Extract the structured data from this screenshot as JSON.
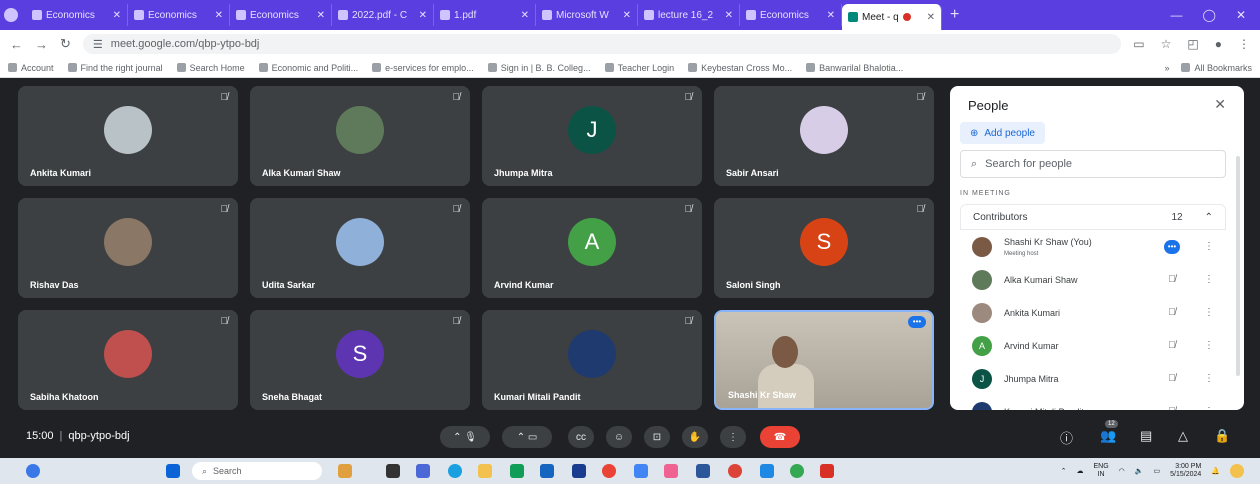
{
  "tabs": [
    {
      "label": "Economics"
    },
    {
      "label": "Economics"
    },
    {
      "label": "Economics"
    },
    {
      "label": "2022.pdf - C"
    },
    {
      "label": "1.pdf"
    },
    {
      "label": "Microsoft W"
    },
    {
      "label": "lecture 16_2"
    },
    {
      "label": "Economics"
    }
  ],
  "active_tab": {
    "label": "Meet - q"
  },
  "url": "meet.google.com/qbp-ytpo-bdj",
  "bookmarks": [
    "Account",
    "Find the right journal",
    "Search Home",
    "Economic and Politi...",
    "e-services for emplo...",
    "Sign in | B. B. Colleg...",
    "Teacher Login",
    "Keybestan Cross Mo...",
    "Banwarilal Bhalotia..."
  ],
  "all_bookmarks": "All Bookmarks",
  "tiles": [
    {
      "name": "Ankita Kumari",
      "kind": "photo",
      "color": "#b9c2c6"
    },
    {
      "name": "Alka Kumari Shaw",
      "kind": "photo",
      "color": "#5f7a5a"
    },
    {
      "name": "Jhumpa Mitra",
      "kind": "letter",
      "letter": "J",
      "color": "#0b5345"
    },
    {
      "name": "Sabir Ansari",
      "kind": "photo",
      "color": "#d8cde6"
    },
    {
      "name": "Rishav Das",
      "kind": "photo",
      "color": "#8a7765"
    },
    {
      "name": "Udita Sarkar",
      "kind": "photo",
      "color": "#8fb0d8"
    },
    {
      "name": "Arvind Kumar",
      "kind": "letter",
      "letter": "A",
      "color": "#43a047"
    },
    {
      "name": "Saloni Singh",
      "kind": "letter",
      "letter": "S",
      "color": "#d84315"
    },
    {
      "name": "Sabiha Khatoon",
      "kind": "photo",
      "color": "#c0504d"
    },
    {
      "name": "Sneha Bhagat",
      "kind": "letter",
      "letter": "S",
      "color": "#5e35b1"
    },
    {
      "name": "Kumari Mitali Pandit",
      "kind": "photo",
      "color": "#1f3a6e"
    },
    {
      "name": "Shashi Kr Shaw",
      "kind": "video",
      "color": "#bdb6aa"
    }
  ],
  "panel": {
    "title": "People",
    "add_people": "Add people",
    "search_placeholder": "Search for people",
    "in_meeting": "IN MEETING",
    "contributors_label": "Contributors",
    "contributors_count": "12",
    "people": [
      {
        "name": "Shashi Kr Shaw (You)",
        "sub": "Meeting host",
        "color": "#7a5a44",
        "letter": "",
        "speaking": true
      },
      {
        "name": "Alka Kumari Shaw",
        "sub": "",
        "color": "#5f7a5a",
        "letter": "",
        "speaking": false
      },
      {
        "name": "Ankita Kumari",
        "sub": "",
        "color": "#9c8a7e",
        "letter": "",
        "speaking": false
      },
      {
        "name": "Arvind Kumar",
        "sub": "",
        "color": "#43a047",
        "letter": "A",
        "speaking": false
      },
      {
        "name": "Jhumpa Mitra",
        "sub": "",
        "color": "#0b5345",
        "letter": "J",
        "speaking": false
      },
      {
        "name": "Kumari Mitali Pandit",
        "sub": "",
        "color": "#1f3a6e",
        "letter": "",
        "speaking": false
      }
    ]
  },
  "meeting": {
    "time": "15:00",
    "code": "qbp-ytpo-bdj",
    "participant_badge": "12"
  },
  "taskbar": {
    "search_label": "Search",
    "lang_top": "ENG",
    "lang_bottom": "IN",
    "time": "3:00 PM",
    "date": "5/15/2024"
  },
  "colors": {
    "tabbar": "#5b3ee0",
    "accent": "#1a73e8",
    "end_call": "#ea4335",
    "tile": "#3c4043"
  }
}
